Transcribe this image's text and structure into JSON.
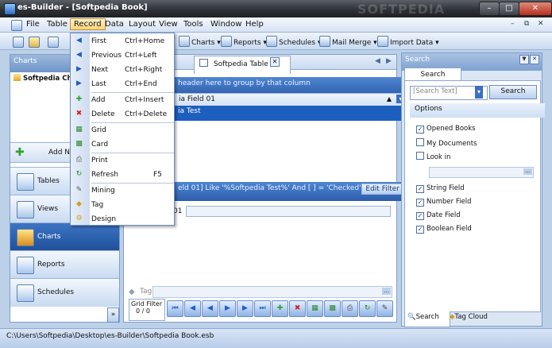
{
  "window": {
    "title": "es-Builder - [Softpedia Book]"
  },
  "menu": [
    "File",
    "Table",
    "Record",
    "Data",
    "Layout",
    "View",
    "Tools",
    "Window",
    "Help"
  ],
  "toolbar": {
    "charts": "Charts",
    "reports": "Reports",
    "schedules": "Schedules",
    "mailmerge": "Mail Merge",
    "importdata": "Import Data"
  },
  "record_menu": [
    {
      "label": "First",
      "shortcut": "Ctrl+Home",
      "icon": "first-icon"
    },
    {
      "label": "Previous",
      "shortcut": "Ctrl+Left",
      "icon": "previous-icon"
    },
    {
      "label": "Next",
      "shortcut": "Ctrl+Right",
      "icon": "next-icon"
    },
    {
      "label": "Last",
      "shortcut": "Ctrl+End",
      "icon": "last-icon"
    },
    {
      "label": "Add",
      "shortcut": "Ctrl+Insert",
      "icon": "add-icon"
    },
    {
      "label": "Delete",
      "shortcut": "Ctrl+Delete",
      "icon": "delete-icon"
    },
    {
      "label": "Grid",
      "shortcut": "",
      "icon": "grid-icon"
    },
    {
      "label": "Card",
      "shortcut": "",
      "icon": "card-icon"
    },
    {
      "label": "Print",
      "shortcut": "",
      "icon": "print-icon"
    },
    {
      "label": "Refresh",
      "shortcut": "F5",
      "icon": "refresh-icon"
    },
    {
      "label": "Mining",
      "shortcut": "",
      "icon": "mining-icon"
    },
    {
      "label": "Tag",
      "shortcut": "",
      "icon": "tag-icon"
    },
    {
      "label": "Design",
      "shortcut": "",
      "icon": "design-icon"
    }
  ],
  "left": {
    "header": "Charts",
    "item": "Softpedia Cha",
    "add_new": "Add Ne",
    "nav": [
      "Tables",
      "Views",
      "Charts",
      "Reports",
      "Schedules"
    ]
  },
  "center": {
    "tab": "Softpedia Table",
    "group_hint": "header here to group by that column",
    "column": "ia Field 01",
    "row_value": "ia Test",
    "filter": "eld 01] Like '%Softpedia Test%' And [ ] = 'Checked'",
    "edit_filter": "Edit Filter",
    "field_label": "01",
    "tag_label": "Tag",
    "grid_filter_label": "Grid Filter",
    "grid_filter_count": "0 / 0"
  },
  "search": {
    "header": "Search",
    "tab": "Search",
    "placeholder": "[Search Text]",
    "button": "Search",
    "options_header": "Options",
    "options": [
      {
        "label": "Opened Books",
        "checked": true
      },
      {
        "label": "My Documents",
        "checked": false
      },
      {
        "label": "Look in",
        "checked": false
      },
      {
        "label": "String Field",
        "checked": true
      },
      {
        "label": "Number Field",
        "checked": true
      },
      {
        "label": "Date Field",
        "checked": true
      },
      {
        "label": "Boolean Field",
        "checked": true
      }
    ],
    "bottom_tabs": [
      "Search",
      "Tag Cloud"
    ]
  },
  "status": {
    "path": "C:\\Users\\Softpedia\\Desktop\\es-Builder\\Softpedia Book.esb"
  },
  "watermark": "SOFTPEDIA"
}
